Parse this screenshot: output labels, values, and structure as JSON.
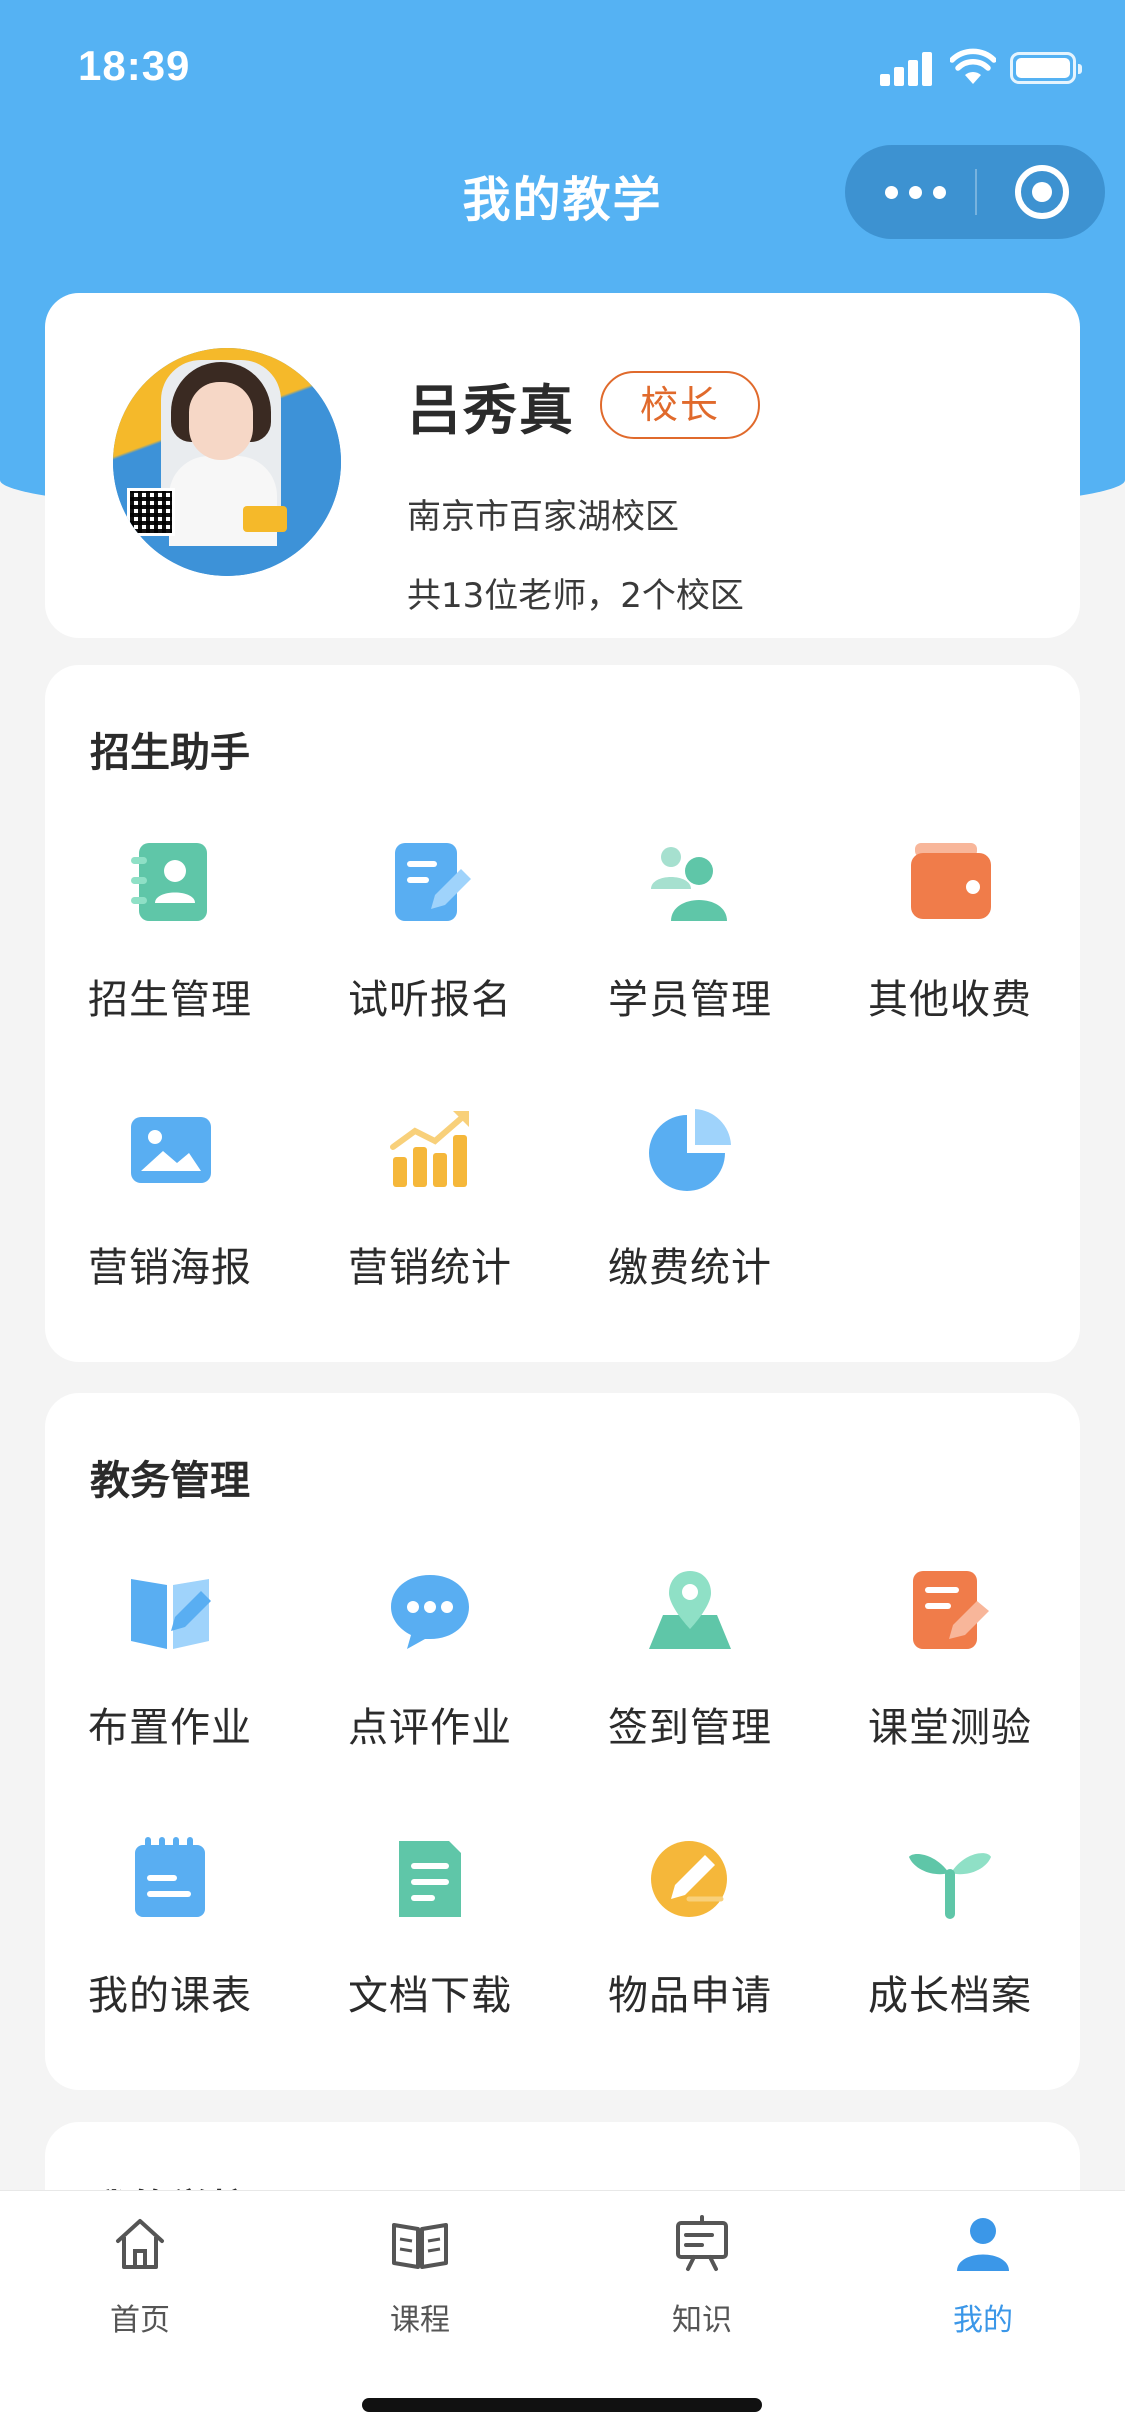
{
  "status_bar": {
    "time": "18:39"
  },
  "nav": {
    "title": "我的教学"
  },
  "profile": {
    "name": "吕秀真",
    "role": "校长",
    "campus": "南京市百家湖校区",
    "summary": "共13位老师，2个校区"
  },
  "sections": {
    "enrollment": {
      "title": "招生助手",
      "items": [
        {
          "label": "招生管理",
          "icon": "contact-card-icon"
        },
        {
          "label": "试听报名",
          "icon": "edit-form-icon"
        },
        {
          "label": "学员管理",
          "icon": "students-icon"
        },
        {
          "label": "其他收费",
          "icon": "wallet-icon"
        },
        {
          "label": "营销海报",
          "icon": "image-poster-icon"
        },
        {
          "label": "营销统计",
          "icon": "bar-trend-icon"
        },
        {
          "label": "缴费统计",
          "icon": "pie-chart-icon"
        }
      ]
    },
    "academic": {
      "title": "教务管理",
      "items": [
        {
          "label": "布置作业",
          "icon": "book-pen-icon"
        },
        {
          "label": "点评作业",
          "icon": "chat-bubble-icon"
        },
        {
          "label": "签到管理",
          "icon": "map-pin-icon"
        },
        {
          "label": "课堂测验",
          "icon": "quiz-note-icon"
        },
        {
          "label": "我的课表",
          "icon": "calendar-icon"
        },
        {
          "label": "文档下载",
          "icon": "document-icon"
        },
        {
          "label": "物品申请",
          "icon": "apply-pen-icon"
        },
        {
          "label": "成长档案",
          "icon": "sprout-icon"
        }
      ]
    },
    "school": {
      "title": "我的学校"
    }
  },
  "tabbar": {
    "items": [
      {
        "label": "首页",
        "icon": "home-icon",
        "active": false
      },
      {
        "label": "课程",
        "icon": "book-icon",
        "active": false
      },
      {
        "label": "知识",
        "icon": "presentation-board-icon",
        "active": false
      },
      {
        "label": "我的",
        "icon": "user-icon",
        "active": true
      }
    ]
  },
  "colors": {
    "header": "#55b2f3",
    "accent": "#3b97e8",
    "role_badge": "#e06a2c"
  }
}
